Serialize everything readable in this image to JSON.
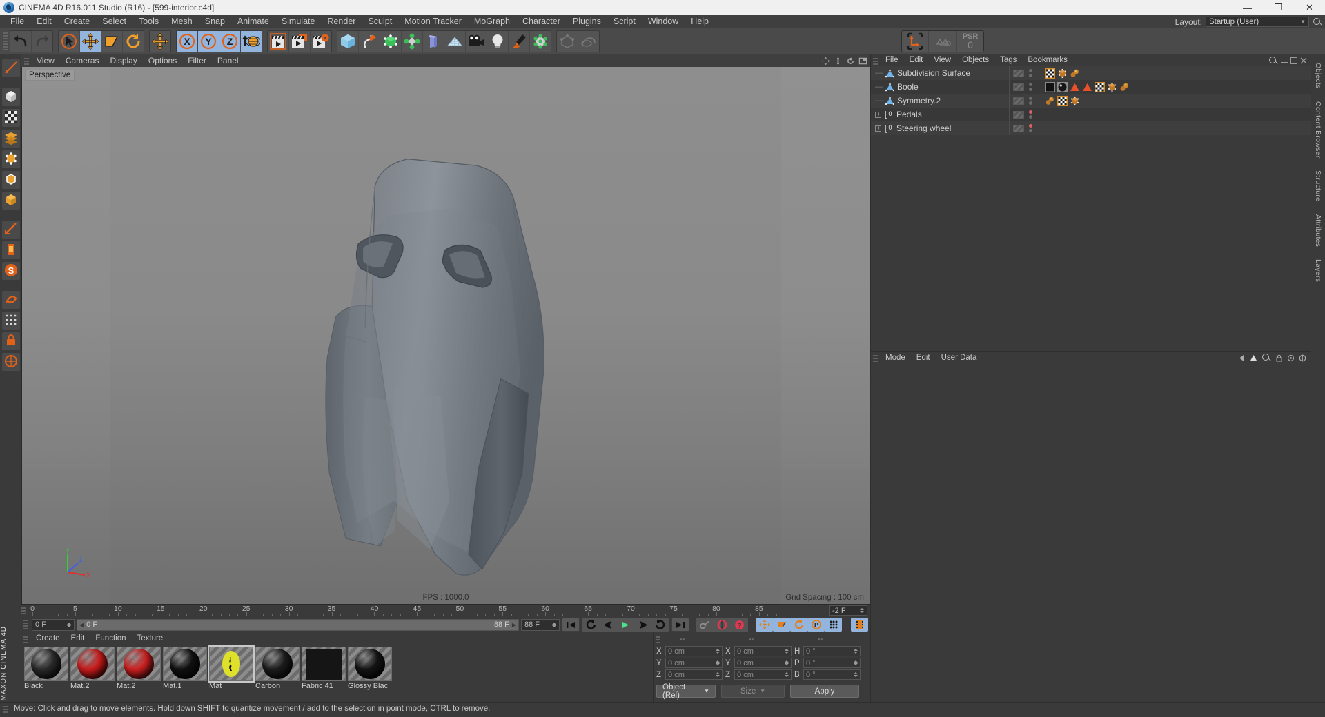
{
  "window": {
    "title": "CINEMA 4D R16.011 Studio (R16) - [599-interior.c4d]",
    "app_icon": "c4d-logo-icon",
    "minimize": "—",
    "maximize": "❐",
    "close": "✕"
  },
  "menubar": {
    "items": [
      "File",
      "Edit",
      "Create",
      "Select",
      "Tools",
      "Mesh",
      "Snap",
      "Animate",
      "Simulate",
      "Render",
      "Sculpt",
      "Motion Tracker",
      "MoGraph",
      "Character",
      "Plugins",
      "Script",
      "Window",
      "Help"
    ],
    "layout_label": "Layout:",
    "layout_value": "Startup (User)"
  },
  "toolbar": {
    "groups": [
      {
        "name": "undo-redo",
        "buttons": [
          {
            "name": "undo-button",
            "icon": "undo-arrow-icon",
            "selected": false
          },
          {
            "name": "redo-button",
            "icon": "redo-arrow-icon",
            "selected": false
          }
        ]
      },
      {
        "name": "transform-tools",
        "buttons": [
          {
            "name": "live-selection-tool",
            "icon": "cursor-circle-icon",
            "selected": false
          },
          {
            "name": "move-tool",
            "icon": "move-cross-icon",
            "selected": true
          },
          {
            "name": "scale-tool",
            "icon": "scale-box-icon",
            "selected": false
          },
          {
            "name": "rotate-tool",
            "icon": "rotate-circle-icon",
            "selected": false
          }
        ]
      },
      {
        "name": "world-object-axis",
        "buttons": [
          {
            "name": "world-coordinate-button",
            "icon": "move-cross-icon",
            "selected": false
          }
        ]
      },
      {
        "name": "axis-locks",
        "buttons": [
          {
            "name": "lock-x-axis-button",
            "icon": "x-axis-icon",
            "selected": true
          },
          {
            "name": "lock-y-axis-button",
            "icon": "y-axis-icon",
            "selected": true
          },
          {
            "name": "lock-z-axis-button",
            "icon": "z-axis-icon",
            "selected": true
          },
          {
            "name": "world-coordinate-system-button",
            "icon": "globe-icon",
            "selected": true
          }
        ]
      },
      {
        "name": "render-tools",
        "buttons": [
          {
            "name": "render-view-button",
            "icon": "clapper-icon",
            "selected": false
          },
          {
            "name": "render-to-picture-viewer-button",
            "icon": "clapper-picture-icon",
            "selected": false
          },
          {
            "name": "render-settings-button",
            "icon": "clapper-gear-icon",
            "selected": false
          }
        ]
      },
      {
        "name": "create-objects",
        "buttons": [
          {
            "name": "add-cube-button",
            "icon": "cube-icon",
            "selected": false
          },
          {
            "name": "add-spline-button",
            "icon": "spline-pen-icon",
            "selected": false
          },
          {
            "name": "add-generator-button",
            "icon": "nurbs-green-cube-icon",
            "selected": false
          },
          {
            "name": "add-array-button",
            "icon": "array-green-icon",
            "selected": false
          },
          {
            "name": "add-deformer-button",
            "icon": "bend-deformer-icon",
            "selected": false
          },
          {
            "name": "add-scene-object-button",
            "icon": "floor-grid-icon",
            "selected": false
          },
          {
            "name": "add-camera-button",
            "icon": "camera-icon",
            "selected": false
          },
          {
            "name": "add-light-button",
            "icon": "lightbulb-icon",
            "selected": false
          },
          {
            "name": "add-paint-button",
            "icon": "paint-pen-icon",
            "selected": false
          },
          {
            "name": "add-joint-button",
            "icon": "joint-points-icon",
            "selected": false
          }
        ]
      },
      {
        "name": "disabled-tools",
        "buttons": [
          {
            "name": "mesh-edit-button",
            "icon": "mesh-wire-icon",
            "selected": false
          },
          {
            "name": "sculpt-button",
            "icon": "sculpt-icon",
            "selected": false
          }
        ]
      }
    ],
    "psr_label": "PSR",
    "psr_value": "0",
    "axis_widget": "l-axis-icon",
    "recycle_widget": "recycle-icon"
  },
  "leftbar": {
    "buttons": [
      {
        "name": "texture-axis-tool",
        "icon": "texture-axis-icon"
      },
      {
        "name": "model-mode-tool",
        "icon": "cube-points-icon"
      },
      {
        "name": "texture-mode-tool",
        "icon": "checker-icon"
      },
      {
        "name": "polygon-mode-tool",
        "icon": "polygon-layers-icon"
      },
      {
        "name": "point-mode-tool",
        "icon": "point-cube-icon"
      },
      {
        "name": "edge-mode-tool",
        "icon": "edge-cube-icon"
      },
      {
        "name": "object-mode-tool",
        "icon": "orange-cube-icon"
      },
      {
        "name": "ruler-tool",
        "icon": "ruler-icon"
      },
      {
        "name": "workplane-tool",
        "icon": "workplane-icon"
      },
      {
        "name": "s-snap-tool",
        "icon": "s-circle-icon"
      },
      {
        "name": "enable-axis-tool",
        "icon": "swirl-axis-icon"
      },
      {
        "name": "enable-snap-tool",
        "icon": "magnet-grid-icon"
      },
      {
        "name": "lock-tool",
        "icon": "padlock-icon"
      },
      {
        "name": "quantize-tool",
        "icon": "quantize-icon"
      }
    ],
    "brand_prefix": "MAXON",
    "brand_name": "CINEMA 4D"
  },
  "viewport": {
    "menu": [
      "View",
      "Cameras",
      "Display",
      "Options",
      "Filter",
      "Panel"
    ],
    "view_label": "Perspective",
    "fps_text": "FPS : 1000.0",
    "grid_text": "Grid Spacing : 100 cm",
    "axis_x": "X",
    "axis_y": "Y",
    "axis_z": "Z",
    "panel_icons": [
      "move-view-icon",
      "scale-view-icon",
      "rotate-view-icon",
      "layout-view-icon"
    ],
    "scene_subject": "car-racing-seat-3d-model"
  },
  "timeline": {
    "ruler_labels": [
      "0",
      "5",
      "10",
      "15",
      "20",
      "25",
      "30",
      "35",
      "40",
      "45",
      "50",
      "55",
      "60",
      "65",
      "70",
      "75",
      "80",
      "85"
    ],
    "ruler_min": 0,
    "ruler_max": 88,
    "end_frame_field": "-2 F",
    "current_frame": "0 F",
    "range_start": "0 F",
    "range_end": "88 F",
    "preview_end": "88 F",
    "transport": [
      {
        "name": "go-to-start-button",
        "icon": "skip-start-icon"
      },
      {
        "name": "play-backwards-keyframe-button",
        "icon": "prev-key-icon"
      },
      {
        "name": "step-back-button",
        "icon": "step-back-icon"
      },
      {
        "name": "play-button",
        "icon": "play-icon"
      },
      {
        "name": "step-forward-button",
        "icon": "step-forward-icon"
      },
      {
        "name": "next-keyframe-button",
        "icon": "next-key-icon"
      },
      {
        "name": "go-to-end-button",
        "icon": "skip-end-icon"
      }
    ],
    "record_tools": [
      {
        "name": "autokey-button",
        "icon": "key-icon"
      },
      {
        "name": "record-active-objects-button",
        "icon": "record-circle-icon"
      },
      {
        "name": "keyframe-selection-button",
        "icon": "question-circle-icon"
      }
    ],
    "param_toggles": [
      {
        "name": "position-key-toggle",
        "icon": "move-cross-icon",
        "selected": true
      },
      {
        "name": "scale-key-toggle",
        "icon": "scale-box-icon",
        "selected": true
      },
      {
        "name": "rotation-key-toggle",
        "icon": "rotate-circle-icon",
        "selected": true
      },
      {
        "name": "param-key-toggle",
        "icon": "p-circle-icon",
        "selected": true
      },
      {
        "name": "point-level-animation-toggle",
        "icon": "dots-grid-icon",
        "selected": true
      }
    ],
    "timeline_button": {
      "name": "open-timeline-button",
      "icon": "filmstrip-icon",
      "selected": true
    }
  },
  "materials": {
    "menu": [
      "Create",
      "Edit",
      "Function",
      "Texture"
    ],
    "items": [
      {
        "name": "Black",
        "type": "sphere",
        "color": "#2a2a2a",
        "selected": false
      },
      {
        "name": "Mat.2",
        "type": "sphere",
        "color": "#c91b1b",
        "selected": false
      },
      {
        "name": "Mat.2",
        "type": "sphere",
        "color": "#cc2020",
        "selected": false
      },
      {
        "name": "Mat.1",
        "type": "sphere",
        "color": "#111111",
        "selected": false
      },
      {
        "name": "Mat",
        "type": "logo",
        "color": "#dfe02a",
        "selected": true
      },
      {
        "name": "Carbon",
        "type": "sphere",
        "color": "#1c1c1c",
        "selected": false
      },
      {
        "name": "Fabric 41",
        "type": "flat",
        "color": "#151515",
        "selected": false
      },
      {
        "name": "Glossy Blac",
        "type": "sphere",
        "color": "#141414",
        "selected": false
      }
    ]
  },
  "coordinates": {
    "headers": [
      "--",
      "--",
      "--"
    ],
    "rows": [
      {
        "pos_label": "X",
        "pos_value": "0 cm",
        "size_label": "X",
        "size_value": "0 cm",
        "rot_label": "H",
        "rot_value": "0 °"
      },
      {
        "pos_label": "Y",
        "pos_value": "0 cm",
        "size_label": "Y",
        "size_value": "0 cm",
        "rot_label": "P",
        "rot_value": "0 °"
      },
      {
        "pos_label": "Z",
        "pos_value": "0 cm",
        "size_label": "Z",
        "size_value": "0 cm",
        "rot_label": "B",
        "rot_value": "0 °"
      }
    ],
    "mode_value": "Object (Rel)",
    "size_value": "Size",
    "apply_label": "Apply"
  },
  "object_manager": {
    "menu": [
      "File",
      "Edit",
      "View",
      "Objects",
      "Tags",
      "Bookmarks"
    ],
    "rows": [
      {
        "name": "Subdivision Surface",
        "icon": "subdivision-triangle-icon",
        "expandable": false,
        "dot_color": "#6a6a6a",
        "tags": [
          "checker-texture-tag",
          "brown-object-tag",
          "orange-spheres-tag"
        ]
      },
      {
        "name": "Boole",
        "icon": "boole-triangle-icon",
        "expandable": false,
        "dot_color": "#6a6a6a",
        "tags": [
          "black-texture-tag",
          "black-sphere-tag",
          "red-triangle-tag",
          "red-triangle-tag",
          "checker-texture-tag",
          "brown-object-tag",
          "orange-spheres-tag"
        ]
      },
      {
        "name": "Symmetry.2",
        "icon": "symmetry-triangle-icon",
        "expandable": false,
        "dot_color": "#6a6a6a",
        "tags": [
          "orange-spheres-tag",
          "checker-texture-tag",
          "brown-object-tag"
        ]
      },
      {
        "name": "Pedals",
        "icon": "null-object-icon",
        "expandable": true,
        "dot_color": "#e06060",
        "tags": []
      },
      {
        "name": "Steering wheel",
        "icon": "null-object-icon",
        "expandable": true,
        "dot_color": "#e06060",
        "tags": []
      }
    ]
  },
  "attributes": {
    "menu": [
      "Mode",
      "Edit",
      "User Data"
    ],
    "icons": [
      "left-arrow-icon",
      "up-arrow-icon",
      "search-icon",
      "lock-icon",
      "pin-icon",
      "target-icon"
    ]
  },
  "side_tabs": [
    "Objects",
    "Content Browser",
    "Structure",
    "Attributes",
    "Layers"
  ],
  "statusbar": {
    "text": "Move: Click and drag to move elements. Hold down SHIFT to quantize movement / add to the selection in point mode, CTRL to remove.",
    "icon": "grip-icon"
  },
  "colors": {
    "accent_blue": "#93b4dc",
    "accent_orange": "#e08020",
    "panel_bg": "#3a3a3a",
    "toolbar_bg": "#4a4a4a",
    "text": "#c8c8c8"
  }
}
